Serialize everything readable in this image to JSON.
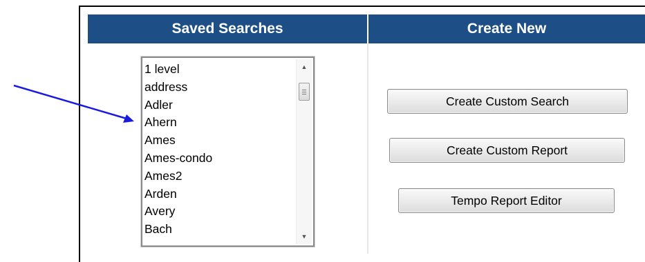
{
  "headers": {
    "saved_searches": "Saved Searches",
    "create_new": "Create New"
  },
  "saved_searches_list": [
    "1 level",
    "address",
    "Adler",
    "Ahern",
    "Ames",
    "Ames-condo",
    "Ames2",
    "Arden",
    "Avery",
    "Bach"
  ],
  "buttons": {
    "create_custom_search": "Create Custom Search",
    "create_custom_report": "Create Custom Report",
    "tempo_report_editor": "Tempo Report Editor"
  },
  "colors": {
    "header_bg": "#1d4f86",
    "header_text": "#ffffff",
    "annotation_arrow": "#1a1adf"
  },
  "icons": {
    "scroll_up": "scroll-up-icon",
    "scroll_down": "scroll-down-icon",
    "annotation_arrow": "annotation-arrow-icon"
  }
}
